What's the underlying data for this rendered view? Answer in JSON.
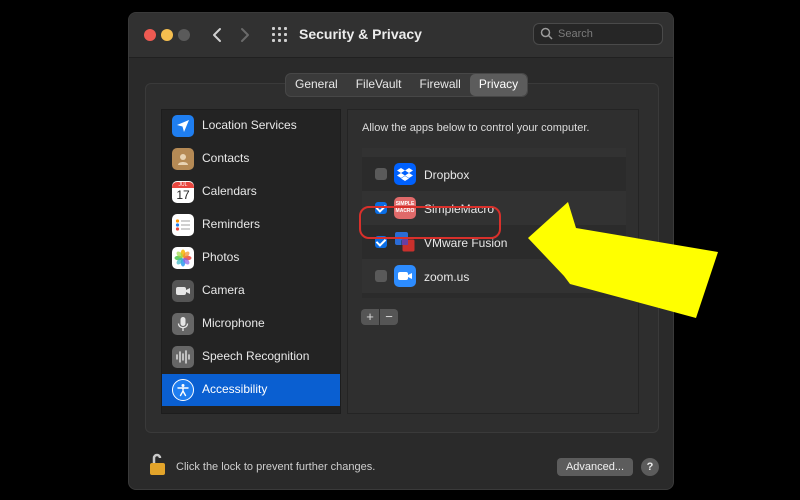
{
  "window": {
    "title": "Security & Privacy"
  },
  "search": {
    "placeholder": "Search"
  },
  "tabs": [
    {
      "label": "General",
      "active": false
    },
    {
      "label": "FileVault",
      "active": false
    },
    {
      "label": "Firewall",
      "active": false
    },
    {
      "label": "Privacy",
      "active": true
    }
  ],
  "sidebar": {
    "items": [
      {
        "label": "Location Services",
        "icon": "location-arrow-icon",
        "color": "#1f7ef0"
      },
      {
        "label": "Contacts",
        "icon": "contacts-book-icon",
        "color": "#b58a55"
      },
      {
        "label": "Calendars",
        "icon": "calendar-icon",
        "color": "#ffffff",
        "date": "17",
        "month": "JUL"
      },
      {
        "label": "Reminders",
        "icon": "reminders-list-icon",
        "color": "#ffffff"
      },
      {
        "label": "Photos",
        "icon": "photos-flower-icon",
        "color": "#ffffff"
      },
      {
        "label": "Camera",
        "icon": "camera-icon",
        "color": "#555555"
      },
      {
        "label": "Microphone",
        "icon": "microphone-icon",
        "color": "#666666"
      },
      {
        "label": "Speech Recognition",
        "icon": "waveform-icon",
        "color": "#666666"
      },
      {
        "label": "Accessibility",
        "icon": "accessibility-person-icon",
        "color": "#1f7ef0",
        "active": true
      }
    ]
  },
  "panel": {
    "description": "Allow the apps below to control your computer.",
    "apps": [
      {
        "name": "Dropbox",
        "checked": false,
        "icon": "dropbox-icon",
        "color": "#0061fe"
      },
      {
        "name": "SimpleMacro",
        "checked": true,
        "icon": "simplemacro-icon",
        "color": "#e06a6a",
        "icon_text": "SIMPLE MACRO"
      },
      {
        "name": "VMware Fusion",
        "checked": true,
        "icon": "vmware-fusion-icon",
        "color": "#2b6cd6"
      },
      {
        "name": "zoom.us",
        "checked": false,
        "icon": "zoom-camera-icon",
        "color": "#2d8cff"
      }
    ],
    "add_label": "+",
    "remove_label": "−"
  },
  "footer": {
    "lock_text": "Click the lock to prevent further changes.",
    "advanced_label": "Advanced...",
    "help_label": "?"
  },
  "colors": {
    "accent": "#0a5fd1",
    "highlight_ring": "#d8302b",
    "annotation_arrow": "#ffff00"
  }
}
